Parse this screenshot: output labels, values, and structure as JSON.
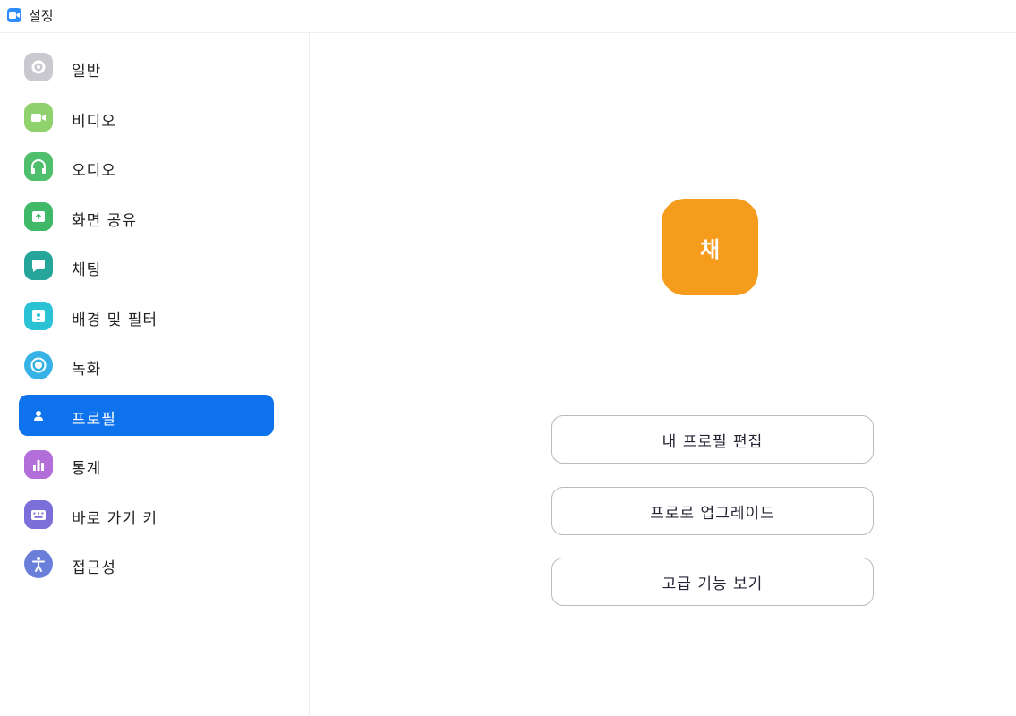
{
  "window": {
    "title": "설정",
    "icon": "video-camera-icon"
  },
  "sidebar": {
    "active_index": 7,
    "items": [
      {
        "label": "일반",
        "icon": "gear-icon",
        "color": "#c9c9cf"
      },
      {
        "label": "비디오",
        "icon": "video-camera-icon",
        "color": "#8fd16d"
      },
      {
        "label": "오디오",
        "icon": "headphones-icon",
        "color": "#4fbf6e"
      },
      {
        "label": "화면 공유",
        "icon": "screen-share-icon",
        "color": "#3fb867"
      },
      {
        "label": "채팅",
        "icon": "chat-bubble-icon",
        "color": "#26a69a"
      },
      {
        "label": "배경 및 필터",
        "icon": "background-person-icon",
        "color": "#2bc2d6"
      },
      {
        "label": "녹화",
        "icon": "record-icon",
        "color": "#36b2e6"
      },
      {
        "label": "프로필",
        "icon": "user-icon",
        "color": "#0e72ed"
      },
      {
        "label": "통계",
        "icon": "bar-chart-icon",
        "color": "#b36fd9"
      },
      {
        "label": "바로 가기 키",
        "icon": "keyboard-icon",
        "color": "#7d6fd9"
      },
      {
        "label": "접근성",
        "icon": "accessibility-icon",
        "color": "#6a7fd9"
      }
    ]
  },
  "profile": {
    "avatar_initial": "채",
    "avatar_color": "#f69c1d",
    "buttons": {
      "edit_profile": "내 프로필 편집",
      "upgrade_pro": "프로로 업그레이드",
      "advanced_features": "고급 기능 보기"
    }
  }
}
